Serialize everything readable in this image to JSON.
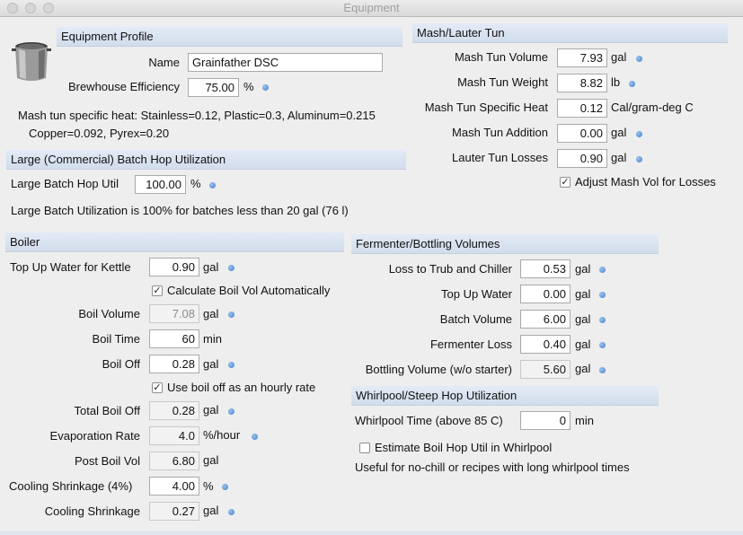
{
  "window": {
    "title": "Equipment"
  },
  "equipment_profile": {
    "header": "Equipment Profile",
    "name_label": "Name",
    "name_value": "Grainfather DSC",
    "efficiency_label": "Brewhouse Efficiency",
    "efficiency_value": "75.00",
    "efficiency_unit": "%",
    "specific_heat_note_1": "Mash tun specific heat: Stainless=0.12, Plastic=0.3, Aluminum=0.215",
    "specific_heat_note_2": "Copper=0.092, Pyrex=0.20"
  },
  "large_batch": {
    "header": "Large (Commercial) Batch Hop Utilization",
    "util_label": "Large Batch Hop Util",
    "util_value": "100.00",
    "util_unit": "%",
    "note": "Large Batch Utilization is 100% for batches less than 20 gal (76 l)"
  },
  "mash": {
    "header": "Mash/Lauter Tun",
    "volume_label": "Mash Tun Volume",
    "volume_value": "7.93",
    "volume_unit": "gal",
    "weight_label": "Mash Tun Weight",
    "weight_value": "8.82",
    "weight_unit": "lb",
    "spec_heat_label": "Mash Tun Specific Heat",
    "spec_heat_value": "0.12",
    "spec_heat_unit": "Cal/gram-deg C",
    "addition_label": "Mash Tun Addition",
    "addition_value": "0.00",
    "addition_unit": "gal",
    "lauter_label": "Lauter Tun Losses",
    "lauter_value": "0.90",
    "lauter_unit": "gal",
    "adjust_label": "Adjust Mash Vol for Losses",
    "adjust_checked": true
  },
  "boiler": {
    "header": "Boiler",
    "topup_label": "Top Up Water for Kettle",
    "topup_value": "0.90",
    "topup_unit": "gal",
    "calc_label": "Calculate Boil Vol Automatically",
    "calc_checked": true,
    "boil_vol_label": "Boil Volume",
    "boil_vol_value": "7.08",
    "boil_vol_unit": "gal",
    "boil_time_label": "Boil Time",
    "boil_time_value": "60",
    "boil_time_unit": "min",
    "boil_off_label": "Boil Off",
    "boil_off_value": "0.28",
    "boil_off_unit": "gal",
    "hourly_label": "Use boil off as an hourly rate",
    "hourly_checked": true,
    "total_off_label": "Total Boil Off",
    "total_off_value": "0.28",
    "total_off_unit": "gal",
    "evap_label": "Evaporation Rate",
    "evap_value": "4.0",
    "evap_unit": "%/hour",
    "post_label": "Post Boil Vol",
    "post_value": "6.80",
    "post_unit": "gal",
    "shrink_pct_label": "Cooling Shrinkage (4%)",
    "shrink_pct_value": "4.00",
    "shrink_pct_unit": "%",
    "shrink_label": "Cooling Shrinkage",
    "shrink_value": "0.27",
    "shrink_unit": "gal"
  },
  "fermenter": {
    "header": "Fermenter/Bottling Volumes",
    "trub_label": "Loss to Trub and Chiller",
    "trub_value": "0.53",
    "trub_unit": "gal",
    "topup_label": "Top Up Water",
    "topup_value": "0.00",
    "topup_unit": "gal",
    "batch_label": "Batch Volume",
    "batch_value": "6.00",
    "batch_unit": "gal",
    "ferm_loss_label": "Fermenter Loss",
    "ferm_loss_value": "0.40",
    "ferm_loss_unit": "gal",
    "bottling_label": "Bottling Volume (w/o starter)",
    "bottling_value": "5.60",
    "bottling_unit": "gal"
  },
  "whirlpool": {
    "header": "Whirlpool/Steep Hop Utilization",
    "time_label": "Whirlpool Time (above 85 C)",
    "time_value": "0",
    "time_unit": "min",
    "estimate_label": "Estimate Boil Hop Util in Whirlpool",
    "estimate_checked": false,
    "note": "Useful for no-chill or recipes with long whirlpool times"
  },
  "icons": {
    "kettle": "kettle-icon",
    "info": "info-dot-icon",
    "check": "✓"
  },
  "colors": {
    "header_bg": "#d6e0ee",
    "info_dot": "#3f7fcd"
  }
}
